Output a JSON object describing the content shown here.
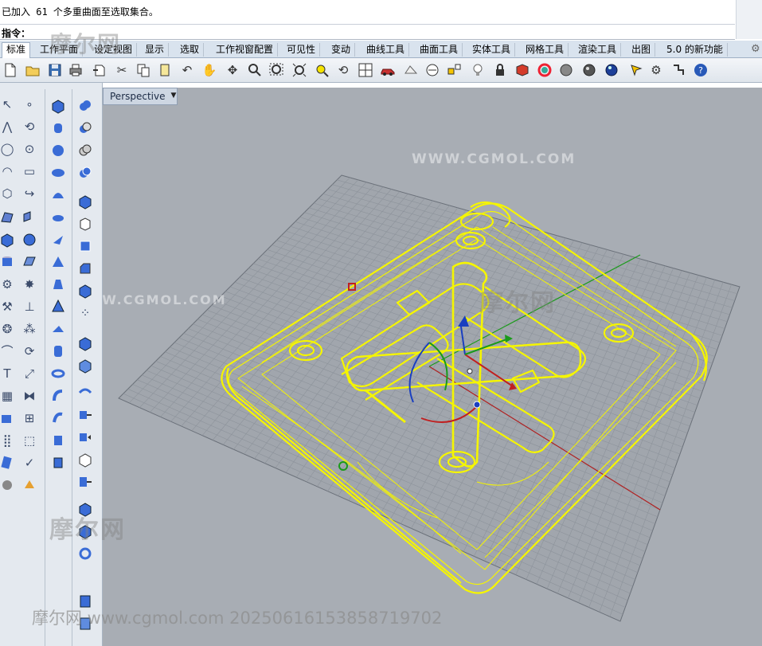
{
  "command_history": {
    "line": "已加入 61 个多重曲面至选取集合。"
  },
  "command_prompt": {
    "label": "指令：",
    "value": ""
  },
  "tabs": [
    {
      "label": "标准",
      "active": true
    },
    {
      "label": "工作平面"
    },
    {
      "label": "设定视图"
    },
    {
      "label": "显示"
    },
    {
      "label": "选取"
    },
    {
      "label": "工作视窗配置"
    },
    {
      "label": "可见性"
    },
    {
      "label": "变动"
    },
    {
      "label": "曲线工具"
    },
    {
      "label": "曲面工具"
    },
    {
      "label": "实体工具"
    },
    {
      "label": "网格工具"
    },
    {
      "label": "渲染工具"
    },
    {
      "label": "出图"
    },
    {
      "label": "5.0 的新功能"
    }
  ],
  "toolbar": {
    "icons": [
      "new-file-icon",
      "open-folder-icon",
      "save-icon",
      "print-icon",
      "import-icon",
      "cut-icon",
      "copy-icon",
      "paste-icon",
      "undo-icon",
      "pan-hand-icon",
      "rotate-view-icon",
      "zoom-icon",
      "zoom-window-icon",
      "zoom-extents-icon",
      "zoom-selected-icon",
      "undo-view-icon",
      "four-viewports-icon",
      "car-icon",
      "render-preview-icon",
      "history-icon",
      "object-snap-icon",
      "light-bulb-icon",
      "lock-icon",
      "material-icon",
      "color-wheel-icon",
      "shaded-sphere-icon",
      "rendered-sphere-icon",
      "glossy-sphere-icon",
      "layer-pen-icon",
      "options-gear-icon",
      "grid-snap-icon",
      "help-icon"
    ]
  },
  "viewport": {
    "title": "Perspective",
    "background_color": "#a8adb4",
    "grid_color": "#8d939b",
    "wire_color": "#f5f500",
    "x_axis_color": "#b02020",
    "y_axis_color": "#1a9a1a"
  },
  "watermarks": {
    "brand_cn": "摩尔网",
    "brand_url_caps": "WWW.CGMOL.COM",
    "footer": "摩尔网 www.cgmol.com 20250616153858719702"
  }
}
